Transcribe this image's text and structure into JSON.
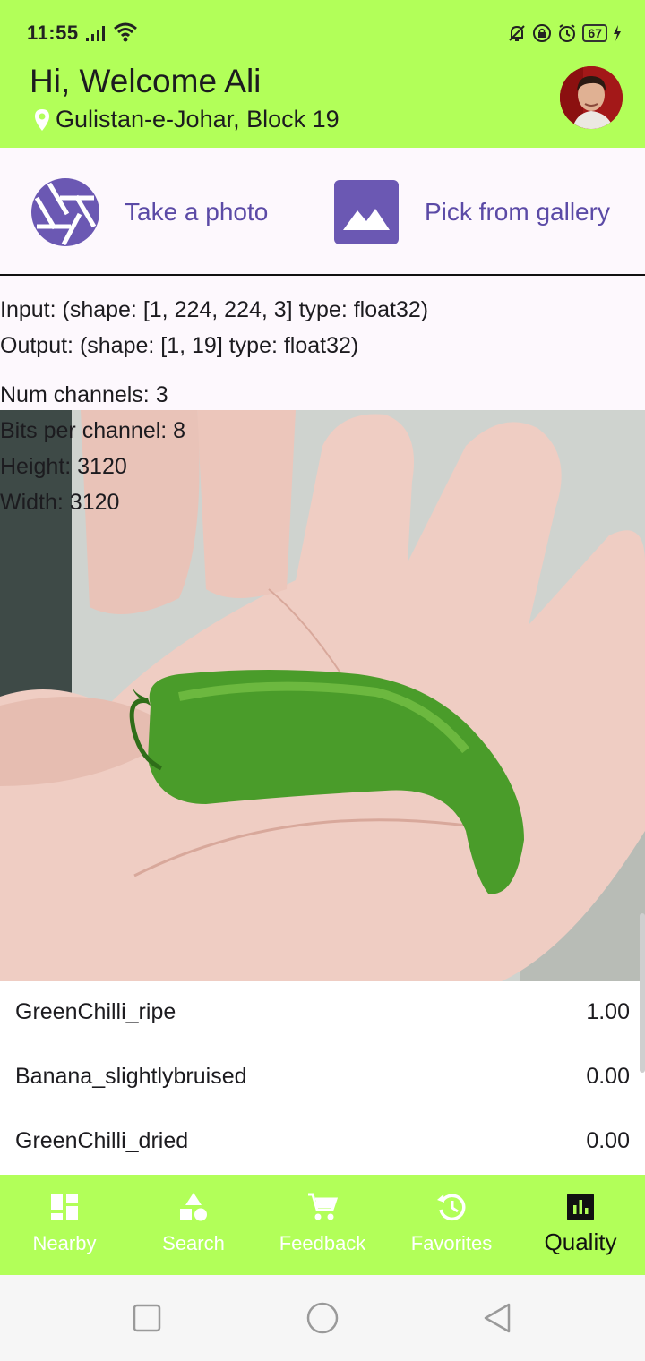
{
  "status_bar": {
    "time": "11:55",
    "battery": "67"
  },
  "header": {
    "greeting": "Hi, Welcome Ali",
    "location": "Gulistan-e-Johar, Block 19",
    "avatar_icon": "user-avatar"
  },
  "actions": {
    "take_photo_label": "Take a photo",
    "gallery_label": "Pick from gallery",
    "camera_icon": "camera-shutter-icon",
    "gallery_icon": "image-icon"
  },
  "model_info": {
    "input": "Input: (shape: [1, 224, 224, 3] type: float32)",
    "output": "Output: (shape: [1, 19] type: float32)",
    "channels": "Num channels: 3",
    "bits": "Bits per channel: 8",
    "height": "Height: 3120",
    "width": "Width: 3120"
  },
  "results": [
    {
      "label": "GreenChilli_ripe",
      "value": "1.00"
    },
    {
      "label": "Banana_slightlybruised",
      "value": "0.00"
    },
    {
      "label": "GreenChilli_dried",
      "value": "0.00"
    }
  ],
  "bottom_nav": [
    {
      "label": "Nearby",
      "icon": "dashboard-icon"
    },
    {
      "label": "Search",
      "icon": "category-icon"
    },
    {
      "label": "Feedback",
      "icon": "cart-icon"
    },
    {
      "label": "Favorites",
      "icon": "history-icon"
    },
    {
      "label": "Quality",
      "icon": "bar-chart-icon",
      "active": true
    }
  ],
  "colors": {
    "accent_green": "#b2ff59",
    "action_purple": "#5b4aa6"
  }
}
